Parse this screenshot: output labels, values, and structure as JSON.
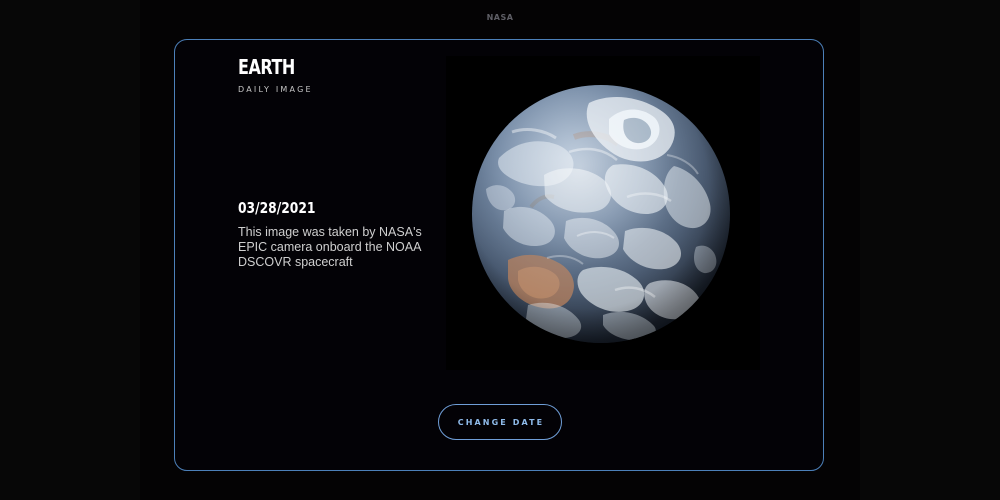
{
  "header": {
    "logo_text": "NASA"
  },
  "card": {
    "title": "EARTH",
    "subtitle": "DAILY IMAGE",
    "date": "03/28/2021",
    "description": "This image was taken by NASA's EPIC camera onboard the NOAA DSCOVR spacecraft",
    "button_label": "CHANGE DATE"
  },
  "image": {
    "subject": "earth-photo"
  },
  "colors": {
    "background": "#070707",
    "card_border": "#4c80b9",
    "button_text": "#8fbbea",
    "text": "#ffffff"
  }
}
